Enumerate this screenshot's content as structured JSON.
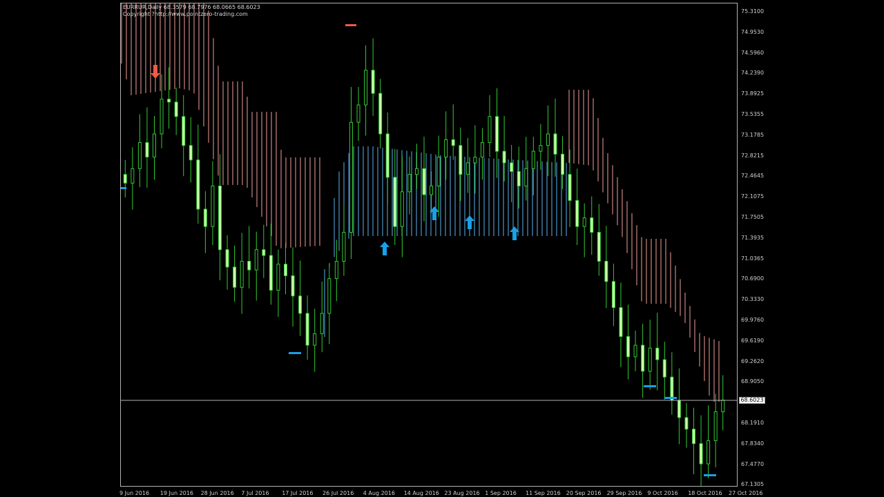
{
  "chart_header": {
    "symbol_line": "EURRUR,Daily  68.3579 68.7976 68.0665 68.6023",
    "copyright_line": "Copyright ?http://www.pointzero-trading.com"
  },
  "current_price": "68.6023",
  "price_axis": [
    "75.3100",
    "74.9530",
    "74.5960",
    "74.2390",
    "73.8925",
    "73.5355",
    "73.1785",
    "72.8215",
    "72.4645",
    "72.1075",
    "71.7505",
    "71.3935",
    "71.0365",
    "70.6900",
    "70.3330",
    "69.9760",
    "69.6190",
    "69.2620",
    "68.9050",
    "68.5480",
    "68.1910",
    "67.8340",
    "67.4770",
    "67.1305"
  ],
  "time_axis": [
    "9 Jun 2016",
    "19 Jun 2016",
    "28 Jun 2016",
    "7 Jul 2016",
    "17 Jul 2016",
    "26 Jul 2016",
    "4 Aug 2016",
    "14 Aug 2016",
    "23 Aug 2016",
    "1 Sep 2016",
    "11 Sep 2016",
    "20 Sep 2016",
    "29 Sep 2016",
    "9 Oct 2016",
    "18 Oct 2016",
    "27 Oct 2016"
  ],
  "colors": {
    "background": "#000000",
    "candle": "#33cc33",
    "candle_body": "#ccffaa",
    "cloud_bear": "#f4a09a",
    "cloud_bull": "#5ab4f0",
    "arrow_up": "#1aa0e6",
    "arrow_down": "#f05a46",
    "price_line": "#b4b4b4"
  },
  "chart_data": {
    "type": "candlestick",
    "symbol": "EURRUR",
    "timeframe": "Daily",
    "last_ohlc": {
      "open": 68.3579,
      "high": 68.7976,
      "low": 68.0665,
      "close": 68.6023
    },
    "ylim": [
      67.1305,
      75.31
    ],
    "candles_close": [
      72.35,
      72.6,
      73.05,
      72.8,
      73.2,
      73.8,
      73.75,
      73.5,
      73.0,
      72.75,
      71.9,
      71.6,
      72.3,
      71.2,
      70.9,
      70.55,
      71.0,
      70.85,
      71.2,
      71.1,
      70.5,
      70.95,
      70.75,
      70.4,
      70.1,
      69.55,
      69.75,
      70.1,
      70.7,
      71.0,
      71.5,
      73.4,
      73.7,
      74.3,
      73.9,
      73.2,
      72.45,
      71.6,
      72.2,
      72.5,
      72.6,
      72.15,
      72.3,
      72.8,
      73.1,
      73.0,
      72.5,
      72.7,
      72.8,
      73.05,
      73.5,
      72.9,
      72.7,
      72.55,
      72.3,
      72.6,
      72.9,
      73.0,
      73.2,
      72.85,
      72.5,
      72.05,
      71.6,
      71.75,
      71.5,
      71.0,
      70.65,
      70.2,
      69.7,
      69.35,
      69.55,
      69.1,
      69.5,
      69.3,
      69.0,
      68.6,
      68.3,
      68.1,
      67.85,
      67.5,
      67.9,
      68.4,
      68.6023
    ],
    "ichimoku_cloud_segments": [
      {
        "from": "9 Jun 2016",
        "to": "26 Jul 2016",
        "trend": "bearish"
      },
      {
        "from": "26 Jul 2016",
        "to": "20 Sep 2016",
        "trend": "bullish"
      },
      {
        "from": "20 Sep 2016",
        "to": "27 Oct 2016",
        "trend": "bearish"
      }
    ],
    "signals": [
      {
        "type": "sell",
        "near": "19 Jun 2016"
      },
      {
        "type": "buy",
        "near": "14 Aug 2016"
      },
      {
        "type": "buy",
        "near": "23 Aug 2016"
      },
      {
        "type": "buy",
        "near": "1 Sep 2016"
      },
      {
        "type": "buy",
        "near": "11 Sep 2016"
      }
    ],
    "grid": false,
    "legend": "none"
  }
}
